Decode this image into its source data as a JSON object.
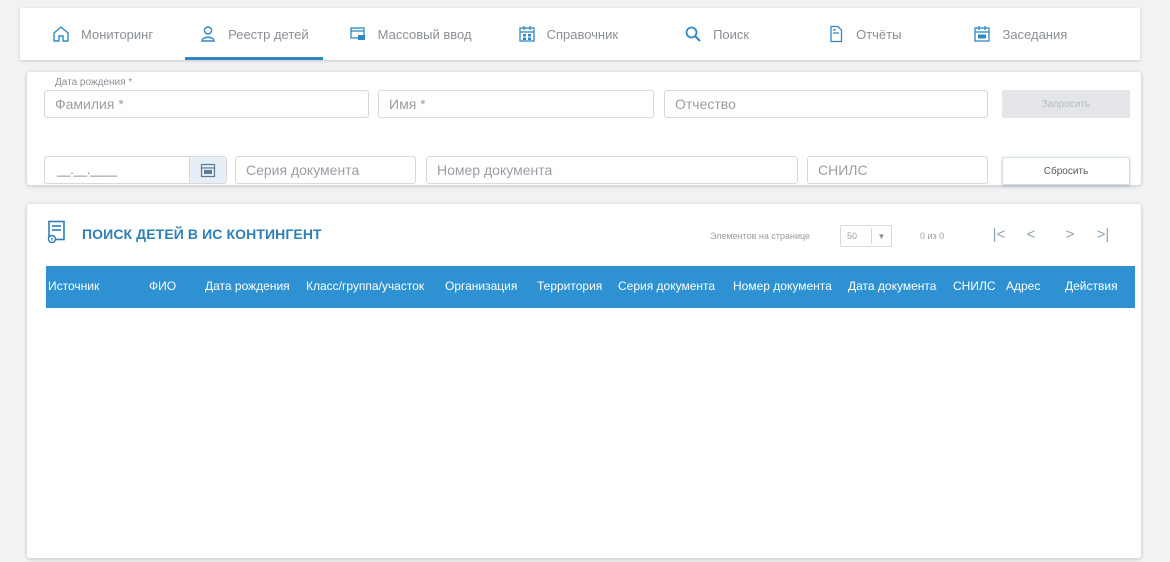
{
  "nav": {
    "items": [
      {
        "label": "Мониторинг",
        "icon": "home-icon"
      },
      {
        "label": "Реестр детей",
        "icon": "user-icon"
      },
      {
        "label": "Массовый ввод",
        "icon": "bulk-input-icon"
      },
      {
        "label": "Справочник",
        "icon": "calendar-grid-icon"
      },
      {
        "label": "Поиск",
        "icon": "search-icon"
      },
      {
        "label": "Отчёты",
        "icon": "document-icon"
      },
      {
        "label": "Заседания",
        "icon": "calendar-icon"
      }
    ],
    "active_index": 1,
    "accent_color": "#2e88c6"
  },
  "filter": {
    "surname_placeholder": "Фамилия *",
    "name_placeholder": "Имя *",
    "patronymic_placeholder": "Отчество",
    "birthdate_label": "Дата рождения *",
    "birthdate_mask": "__.__.____",
    "doc_series_placeholder": "Серия документа",
    "doc_number_placeholder": "Номер документа",
    "snils_placeholder": "СНИЛС",
    "request_button": "Запросить",
    "reset_button": "Сбросить"
  },
  "results": {
    "title": "ПОИСК ДЕТЕЙ В ИС КОНТИНГЕНТ",
    "per_page_label": "Элементов на странице",
    "per_page_value": "50",
    "count_text": "0 из 0",
    "pager": {
      "first": "|<",
      "prev": "<",
      "next": ">",
      "last": ">|"
    },
    "columns": [
      "Источник",
      "ФИО",
      "Дата рождения",
      "Класс/группа/участок",
      "Организация",
      "Территория",
      "Серия документа",
      "Номер документа",
      "Дата документа",
      "СНИЛС",
      "Адрес",
      "Действия"
    ],
    "header_color": "#2e91d1",
    "title_color": "#2e7fb8"
  }
}
